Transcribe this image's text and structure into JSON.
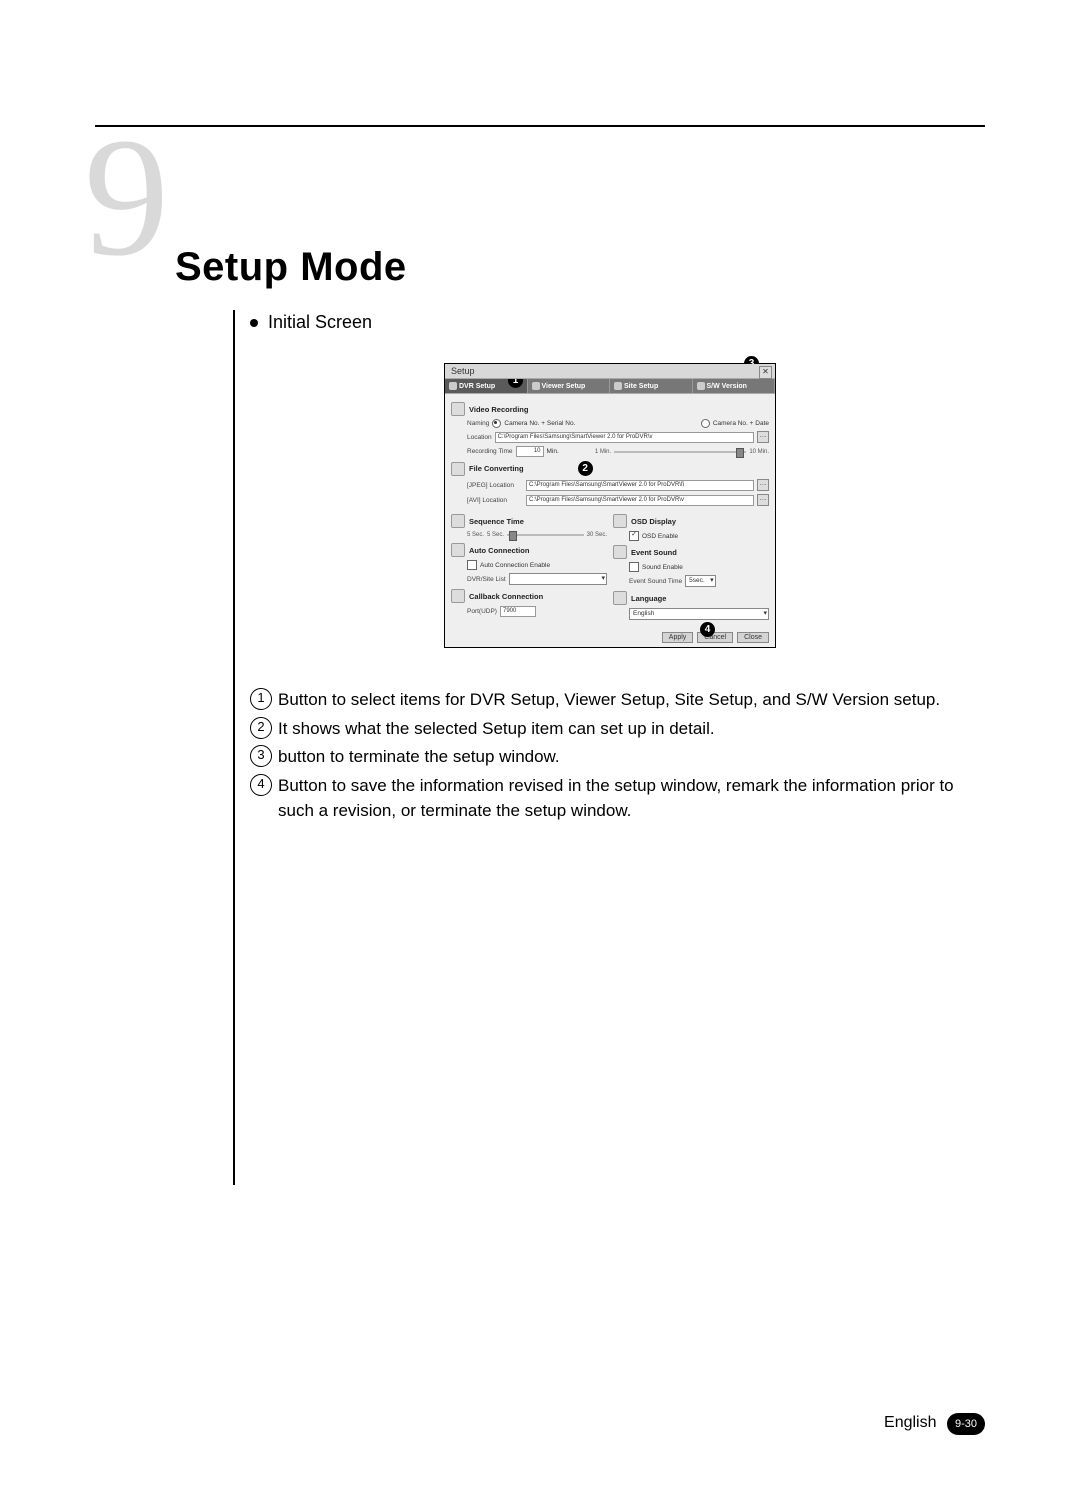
{
  "chapter": {
    "number": "9",
    "title": "Setup Mode"
  },
  "section": {
    "bullet": "Initial Screen"
  },
  "screenshot": {
    "window_title": "Setup",
    "close_glyph": "✕",
    "tabs": [
      {
        "label": "DVR Setup"
      },
      {
        "label": "Viewer Setup"
      },
      {
        "label": "Site Setup"
      },
      {
        "label": "S/W Version"
      }
    ],
    "sections": {
      "video_recording": {
        "title": "Video Recording",
        "naming_label": "Naming",
        "naming_opt1": "Camera No. + Serial No.",
        "naming_opt2": "Camera No. + Date",
        "location_label": "Location",
        "location_value": "C:\\Program Files\\Samsung\\SmartViewer 2.0 for ProDVR\\v",
        "rec_time_label": "Recording Time",
        "rec_time_value": "10",
        "rec_time_unit": "Min.",
        "rec_time_min": "1 Min.",
        "rec_time_max": "10 Min."
      },
      "file_converting": {
        "title": "File Converting",
        "jpeg_label": "[JPEG]   Location",
        "jpeg_value": "C:\\Program Files\\Samsung\\SmartViewer 2.0 for ProDVR\\fi",
        "avi_label": "[AVI]    Location",
        "avi_value": "C:\\Program Files\\Samsung\\SmartViewer 2.0 for ProDVR\\v"
      },
      "sequence_time": {
        "title": "Sequence Time",
        "min": "5 Sec.",
        "mid": "5 Sec.",
        "max": "30 Sec."
      },
      "osd_display": {
        "title": "OSD Display",
        "check_label": "OSD Enable"
      },
      "auto_connection": {
        "title": "Auto Connection",
        "check_label": "Auto Connection Enable",
        "list_label": "DVR/Site List"
      },
      "event_sound": {
        "title": "Event Sound",
        "check_label": "Sound Enable",
        "time_label": "Event Sound Time",
        "time_value": "5sec."
      },
      "callback": {
        "title": "Callback Connection",
        "port_label": "Port(UDP)",
        "port_value": "7900"
      },
      "language": {
        "title": "Language",
        "value": "English"
      }
    },
    "buttons": {
      "apply": "Apply",
      "cancel": "Cancel",
      "close": "Close"
    },
    "callouts": {
      "c1": "1",
      "c2": "2",
      "c3": "3",
      "c4": "4"
    }
  },
  "descriptions": [
    {
      "num": "1",
      "text": "Button to select items for DVR Setup, Viewer Setup, Site Setup, and S/W Version setup."
    },
    {
      "num": "2",
      "text": "It shows what the selected Setup item can set up in detail."
    },
    {
      "num": "3",
      "text": "button to terminate the setup window."
    },
    {
      "num": "4",
      "text": "Button to save the information revised in the setup window, remark the information prior to such a revision, or terminate the setup window."
    }
  ],
  "footer": {
    "lang": "English",
    "page": "9-30"
  }
}
